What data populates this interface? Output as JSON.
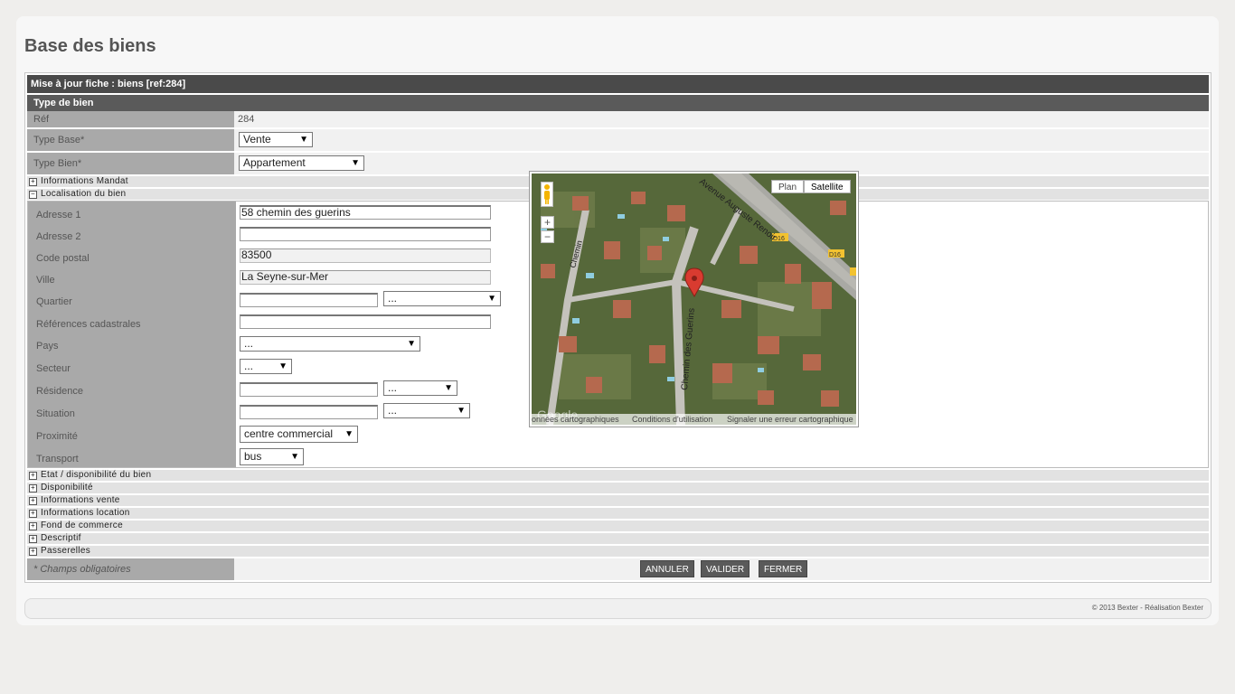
{
  "page_title": "Base des biens",
  "form_header": "Mise à jour fiche : biens [ref:284]",
  "type_section": {
    "title": "Type de bien",
    "ref_label": "Réf",
    "ref_value": "284",
    "type_base_label": "Type Base*",
    "type_base_value": "Vente",
    "type_bien_label": "Type Bien*",
    "type_bien_value": "Appartement"
  },
  "sections": {
    "informations_mandat": "Informations Mandat",
    "localisation": "Localisation du bien",
    "etat": "Etat / disponibilité du bien",
    "disponibilite": "Disponibilité",
    "informations_vente": "Informations vente",
    "informations_location": "Informations location",
    "fond_commerce": "Fond de commerce",
    "descriptif": "Descriptif",
    "passerelles": "Passerelles"
  },
  "localisation": {
    "adresse1_label": "Adresse 1",
    "adresse1_value": "58 chemin des guerins",
    "adresse2_label": "Adresse 2",
    "code_postal_label": "Code postal",
    "code_postal_value": "83500",
    "ville_label": "Ville",
    "ville_value": "La Seyne-sur-Mer",
    "quartier_label": "Quartier",
    "quartier_select": "...",
    "references_label": "Références cadastrales",
    "pays_label": "Pays",
    "pays_select": "...",
    "secteur_label": "Secteur",
    "secteur_select": "...",
    "residence_label": "Résidence",
    "residence_select": "...",
    "situation_label": "Situation",
    "situation_select": "...",
    "proximite_label": "Proximité",
    "proximite_select": "centre commercial",
    "transport_label": "Transport",
    "transport_select": "bus"
  },
  "map": {
    "plan_label": "Plan",
    "satellite_label": "Satellite",
    "zoom_in": "+",
    "zoom_out": "−",
    "data_text": "onnées cartographiques",
    "terms_text": "Conditions d'utilisation",
    "report_text": "Signaler une erreur cartographique",
    "google_logo": "Google",
    "road_label_1": "Avenue Auguste Renoir",
    "road_label_2": "Chemin des Guerins",
    "road_label_3": "Chemin",
    "d16_label": "D16",
    "colors": {
      "satellite_green": "#5b6b3c",
      "road": "#bdbdb8",
      "marker": "#d93b30"
    }
  },
  "footer": {
    "required_note": "* Champs obligatoires",
    "annuler": "ANNULER",
    "valider": "VALIDER",
    "fermer": "FERMER",
    "copyright": "© 2013 Bexter - Réalisation Bexter"
  }
}
